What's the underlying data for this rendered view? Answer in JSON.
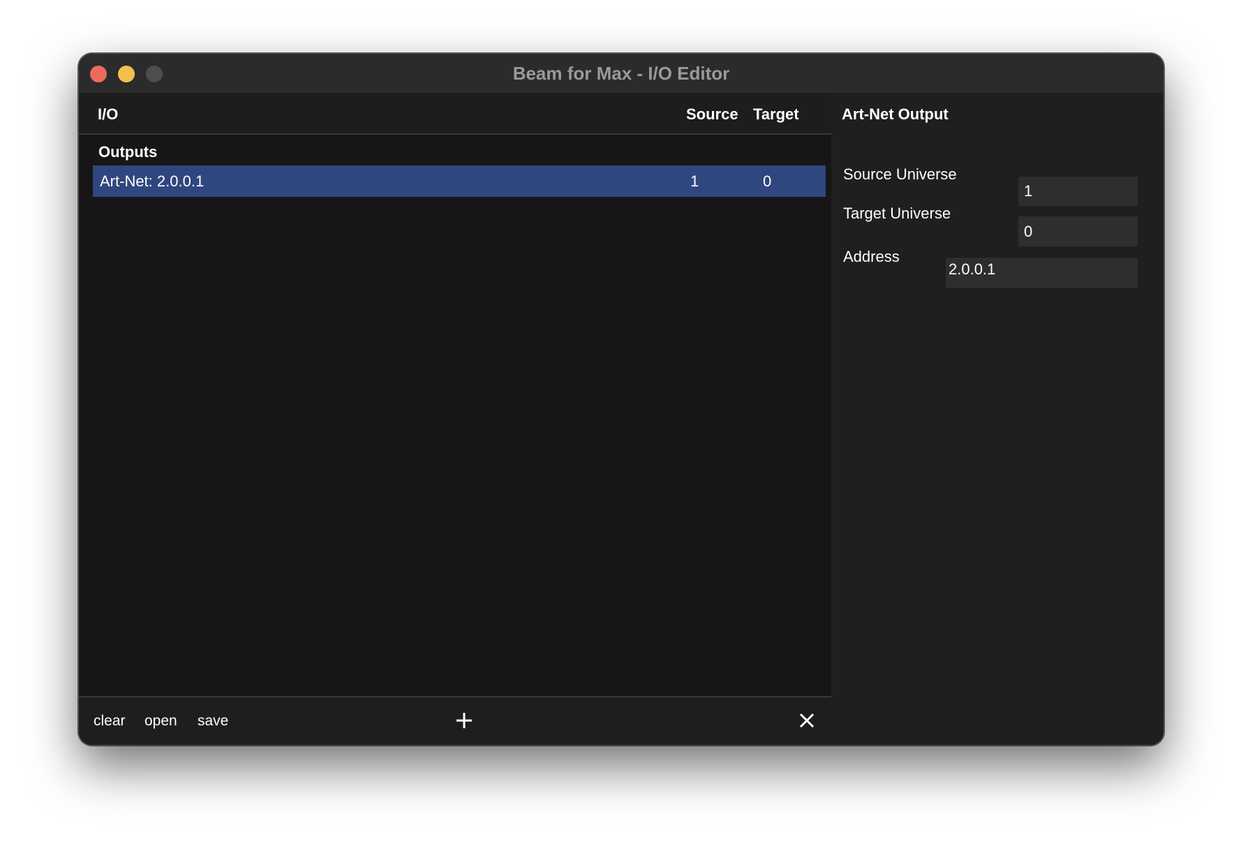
{
  "window": {
    "title": "Beam for Max - I/O Editor"
  },
  "io_list": {
    "header": {
      "io": "I/O",
      "source": "Source",
      "target": "Target"
    },
    "groups": [
      {
        "label": "Outputs",
        "rows": [
          {
            "name": "Art-Net: 2.0.0.1",
            "source": "1",
            "target": "0",
            "selected": true
          }
        ]
      }
    ],
    "footer": {
      "clear": "clear",
      "open": "open",
      "save": "save",
      "add_icon": "plus-icon",
      "remove_icon": "close-icon"
    }
  },
  "properties": {
    "title": "Art-Net Output",
    "source_universe_label": "Source Universe",
    "source_universe_value": "1",
    "target_universe_label": "Target Universe",
    "target_universe_value": "0",
    "address_label": "Address",
    "address_value": "2.0.0.1"
  },
  "colors": {
    "selection": "#30467e",
    "traffic_close": "#ed6a5e",
    "traffic_minimize": "#f5bf4f",
    "traffic_zoom_disabled": "#4d4d4d"
  }
}
